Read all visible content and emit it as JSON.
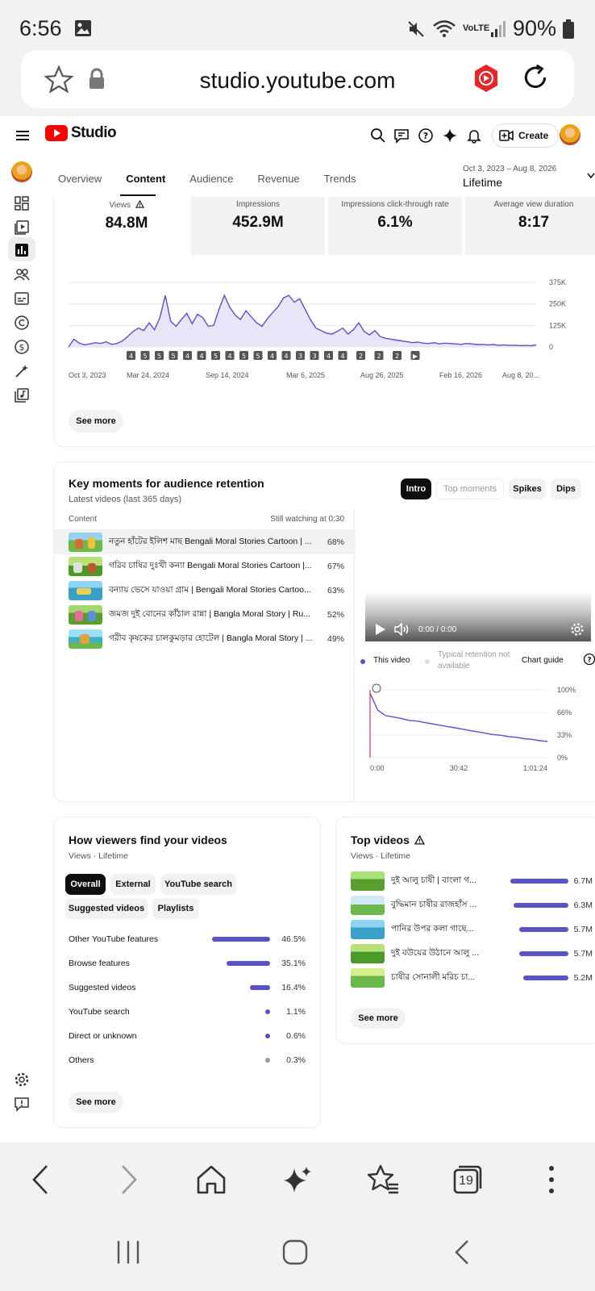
{
  "status_bar": {
    "time": "6:56",
    "battery": "90%",
    "network": "VoLTE"
  },
  "browser": {
    "url": "studio.youtube.com"
  },
  "header": {
    "logo_text": "Studio",
    "create_label": "Create"
  },
  "tabs": [
    {
      "label": "Overview"
    },
    {
      "label": "Content"
    },
    {
      "label": "Audience"
    },
    {
      "label": "Revenue"
    },
    {
      "label": "Trends"
    }
  ],
  "date_range": {
    "range": "Oct 3, 2023 – Aug 8, 2026",
    "label": "Lifetime"
  },
  "metrics": [
    {
      "label": "Views",
      "value": "84.8M"
    },
    {
      "label": "Impressions",
      "value": "452.9M"
    },
    {
      "label": "Impressions click-through rate",
      "value": "6.1%"
    },
    {
      "label": "Average view duration",
      "value": "8:17"
    }
  ],
  "chart_data": {
    "type": "area",
    "x_ticks": [
      "Oct 3, 2023",
      "Mar 24, 2024",
      "Sep 14, 2024",
      "Mar 6, 2025",
      "Aug 26, 2025",
      "Feb 16, 2026",
      "Aug 8, 20..."
    ],
    "y_ticks": [
      "375K",
      "250K",
      "125K",
      "0"
    ],
    "ylim": [
      0,
      375000
    ],
    "markers": [
      "4",
      "5",
      "5",
      "5",
      "4",
      "4",
      "5",
      "4",
      "5",
      "5",
      "4",
      "4",
      "3",
      "3",
      "4",
      "4",
      "2",
      "2",
      "2",
      "▶"
    ],
    "series": [
      {
        "values": [
          0,
          45000,
          22000,
          12000,
          18000,
          25000,
          20000,
          30000,
          15000,
          20000,
          35000,
          60000,
          90000,
          110000,
          95000,
          140000,
          100000,
          170000,
          300000,
          150000,
          120000,
          160000,
          195000,
          135000,
          190000,
          170000,
          120000,
          125000,
          220000,
          300000,
          230000,
          185000,
          160000,
          210000,
          175000,
          140000,
          120000,
          165000,
          200000,
          235000,
          285000,
          300000,
          260000,
          280000,
          220000,
          160000,
          110000,
          95000,
          80000,
          75000,
          90000,
          110000,
          75000,
          100000,
          140000,
          90000,
          70000,
          95000,
          60000,
          50000,
          45000,
          40000,
          35000,
          30000,
          25000,
          28000,
          22000,
          20000,
          25000,
          18000,
          22000,
          20000,
          18000,
          15000,
          20000,
          18000,
          14000,
          15000,
          12000,
          14000,
          10000,
          12000,
          9000,
          10000,
          8000,
          9000,
          7000,
          12000
        ]
      }
    ]
  },
  "overview": {
    "see_more": "See more"
  },
  "retention": {
    "title": "Key moments for audience retention",
    "subtitle": "Latest videos (last 365 days)",
    "chips": [
      "Intro",
      "Top moments",
      "Spikes",
      "Dips"
    ],
    "col_content": "Content",
    "col_still": "Still watching at 0:30",
    "videos": [
      {
        "title": "নতুন হাঁটের ইলিশ মাছ Bengali Moral Stories Cartoon | ...",
        "pct": "68%"
      },
      {
        "title": "গরিব চাষির দুঃখী কন্যা Bengali Moral Stories Cartoon |...",
        "pct": "67%"
      },
      {
        "title": "বন্যায় ভেসে যাওয়া গ্রাম | Bengali Moral Stories Cartoo...",
        "pct": "63%"
      },
      {
        "title": "জমজ দুই বোনের কাঁঠাল রান্না | Bangla Moral Story | Ru...",
        "pct": "52%"
      },
      {
        "title": "গরীব কৃষকের চালকুমড়ার হোটেল | Bangla Moral Story | ...",
        "pct": "49%"
      }
    ],
    "player_time": "0:00 / 0:00",
    "legend_this": "This video",
    "legend_typical": "Typical retention not available",
    "chart_guide": "Chart guide",
    "chart_data": {
      "type": "line",
      "y_ticks": [
        "100%",
        "66%",
        "33%",
        "0%"
      ],
      "x_ticks": [
        "0:00",
        "30:42",
        "1:01:24"
      ],
      "ylim": [
        0,
        100
      ],
      "values": [
        95,
        70,
        62,
        60,
        58,
        55,
        54,
        52,
        50,
        48,
        46,
        44,
        42,
        40,
        38,
        36,
        34,
        33,
        31,
        30,
        28,
        27,
        25,
        24
      ]
    }
  },
  "find_card": {
    "title": "How viewers find your videos",
    "subtitle": "Views · Lifetime",
    "chips": [
      "Overall",
      "External",
      "YouTube search",
      "Suggested videos",
      "Playlists"
    ],
    "sources": [
      {
        "label": "Other YouTube features",
        "pct": "46.5%",
        "value": 46.5
      },
      {
        "label": "Browse features",
        "pct": "35.1%",
        "value": 35.1
      },
      {
        "label": "Suggested videos",
        "pct": "16.4%",
        "value": 16.4
      },
      {
        "label": "YouTube search",
        "pct": "1.1%",
        "value": 1.1
      },
      {
        "label": "Direct or unknown",
        "pct": "0.6%",
        "value": 0.6
      },
      {
        "label": "Others",
        "pct": "0.3%",
        "value": 0.3
      }
    ],
    "see_more": "See more"
  },
  "top_card": {
    "title": "Top videos",
    "subtitle": "Views · Lifetime",
    "videos": [
      {
        "title": "দুই আলু চাষী | বাংলা গ...",
        "views": "6.7M",
        "value": 6.7
      },
      {
        "title": "বুদ্ধিমান চাষীর রাজহাঁস ...",
        "views": "6.3M",
        "value": 6.3
      },
      {
        "title": "পানির উপর কলা গাছে...",
        "views": "5.7M",
        "value": 5.7
      },
      {
        "title": "দুই বউয়ের উঠানে আলু ...",
        "views": "5.7M",
        "value": 5.7
      },
      {
        "title": "চাষীর সোনালী মরিচ চা...",
        "views": "5.2M",
        "value": 5.2
      }
    ],
    "see_more": "See more"
  },
  "browser_bottom": {
    "tab_count": "19"
  },
  "colors": {
    "accent": "#5a52c7",
    "youtube_red": "#ff0000",
    "chart_fill": "#e7e5f7"
  }
}
